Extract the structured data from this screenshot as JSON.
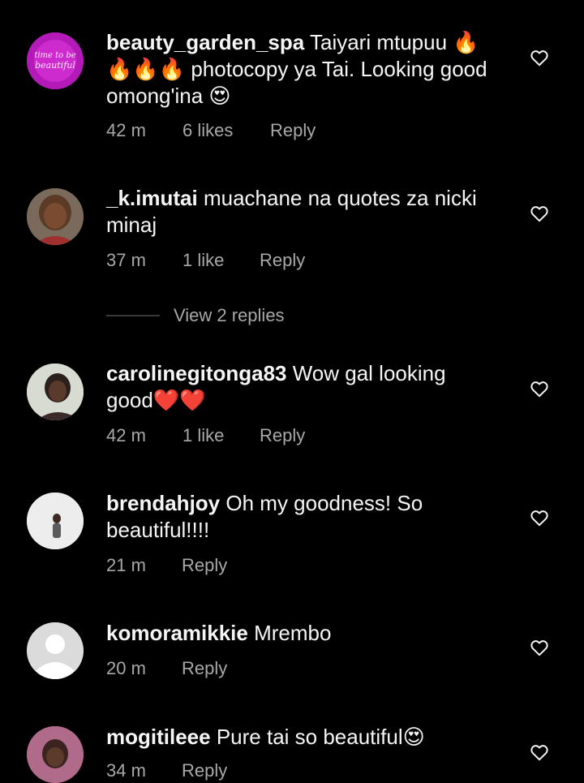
{
  "comments": [
    {
      "username": "beauty_garden_spa",
      "text": "Taiyari mtupuu 🔥 🔥🔥🔥 photocopy ya Tai. Looking good omong'ina 😍",
      "time": "42 m",
      "likes": "6 likes",
      "reply_label": "Reply",
      "avatar_text": "time to be beautiful",
      "avatar_color": "#d61fd0"
    },
    {
      "username": "_k.imutai",
      "text": "muachane na quotes za nicki minaj",
      "time": "37 m",
      "likes": "1 like",
      "reply_label": "Reply",
      "avatar_color": "#5a3b2a"
    },
    {
      "username": "carolinegitonga83",
      "text": "Wow gal looking good❤️❤️",
      "time": "42 m",
      "likes": "1 like",
      "reply_label": "Reply",
      "avatar_color": "#cfd3c8"
    },
    {
      "username": "brendahjoy",
      "text": "Oh my goodness! So beautiful!!!!",
      "time": "21 m",
      "reply_label": "Reply",
      "avatar_color": "#e9e9e9"
    },
    {
      "username": "komoramikkie",
      "text": "Mrembo",
      "time": "20 m",
      "reply_label": "Reply",
      "avatar_color": "#d9d9d9"
    },
    {
      "username": "mogitileee",
      "text": "Pure tai so beautiful😍",
      "time": "34 m",
      "reply_label": "Reply",
      "avatar_color": "#8a5a6a"
    }
  ],
  "view_replies": "View 2 replies",
  "colors": {
    "background": "#000000",
    "text": "#f5f5f5",
    "muted": "#a8a8a8",
    "heart_stroke": "#f5f5f5"
  },
  "icons": {
    "like": "heart-outline-icon",
    "default_avatar": "default-avatar-icon"
  }
}
